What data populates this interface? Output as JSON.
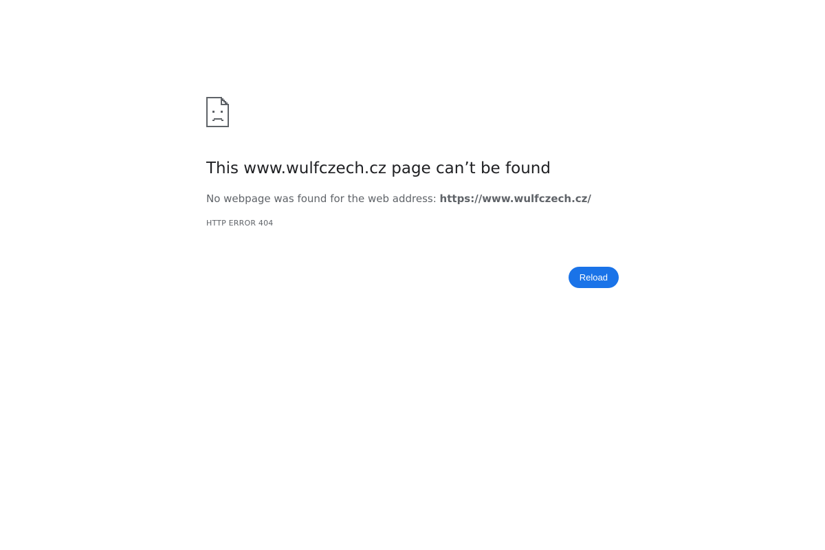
{
  "icon": "sad-page-icon",
  "heading": "This www.wulfczech.cz page can’t be found",
  "message": {
    "prefix": "No webpage was found for the web address: ",
    "url": "https://www.wulfczech.cz/"
  },
  "error_code": "HTTP ERROR 404",
  "reload_label": "Reload",
  "colors": {
    "accent": "#1a73e8",
    "heading": "#202124",
    "secondary_text": "#5f6368"
  }
}
